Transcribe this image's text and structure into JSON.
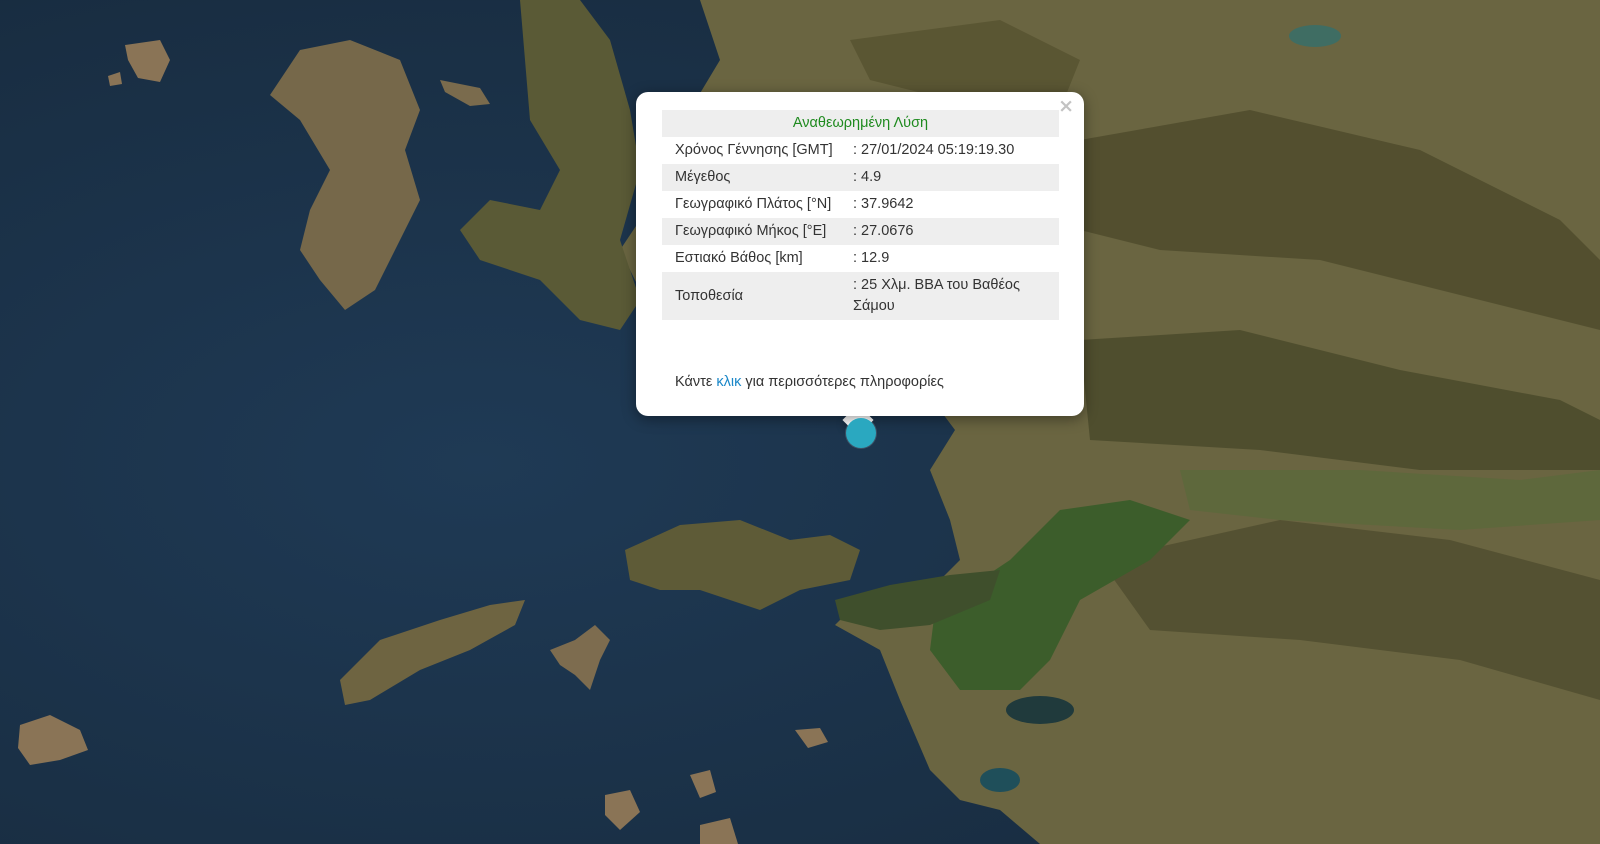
{
  "popup": {
    "close_label": "×",
    "title": "Αναθεωρημένη Λύση",
    "rows": [
      {
        "label": "Χρόνος Γέννησης [GMT]",
        "value": ": 27/01/2024 05:19:19.30"
      },
      {
        "label": "Μέγεθος",
        "value": ": 4.9"
      },
      {
        "label": "Γεωγραφικό Πλάτος [°N]",
        "value": ": 37.9642"
      },
      {
        "label": "Γεωγραφικό Μήκος [°E]",
        "value": ": 27.0676"
      },
      {
        "label": "Εστιακό Βάθος [km]",
        "value": ": 12.9"
      },
      {
        "label": "Τοποθεσία",
        "value": ": 25 Χλμ. ΒΒΑ του Βαθέος Σάμου"
      }
    ],
    "more_prefix": "Κάντε ",
    "more_link": "κλικ",
    "more_suffix": " για περισσότερες πληροφορίες"
  },
  "colors": {
    "sea": "#1b3147",
    "land": "#66633f",
    "land_green": "#3e5a2c",
    "mountain": "#4c4a2c",
    "title_green": "#1e8a1e",
    "link_blue": "#1a87c8",
    "marker": "#2aa8c0"
  },
  "marker": {
    "icon": "epicenter-circle-icon"
  }
}
